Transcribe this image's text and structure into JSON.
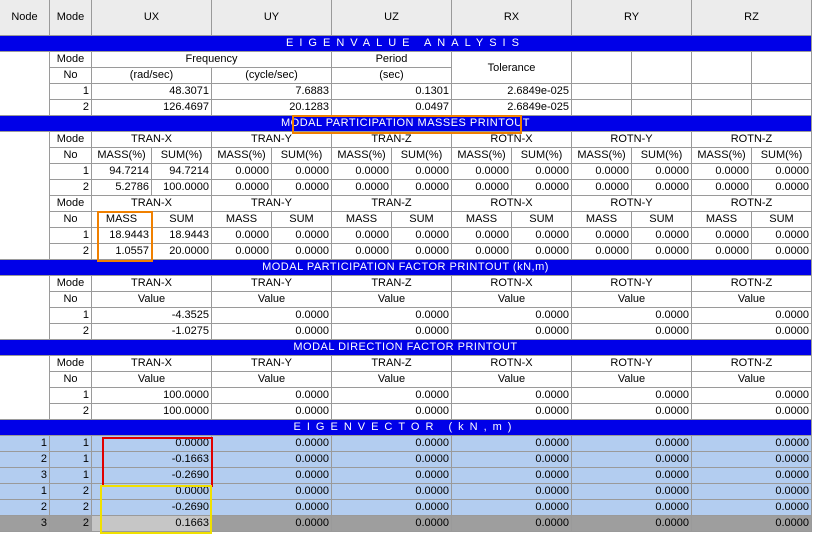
{
  "columns": [
    "Node",
    "Mode",
    "UX",
    "UY",
    "UZ",
    "RX",
    "RY",
    "RZ"
  ],
  "eigenvalue": {
    "title": "EIGENVALUE ANALYSIS",
    "mode_label": [
      "Mode",
      "No"
    ],
    "frequency_label": "Frequency",
    "rad_label": "(rad/sec)",
    "cycle_label": "(cycle/sec)",
    "period_label": "Period",
    "sec_label": "(sec)",
    "tolerance_label": "Tolerance",
    "rows": [
      {
        "mode": "1",
        "rad": "48.3071",
        "cycle": "7.6883",
        "period": "0.1301",
        "tol": "2.6849e-025"
      },
      {
        "mode": "2",
        "rad": "126.4697",
        "cycle": "20.1283",
        "period": "0.0497",
        "tol": "2.6849e-025"
      }
    ]
  },
  "mass_participation": {
    "title": "MODAL PARTICIPATION MASSES PRINTOUT",
    "groups": [
      "TRAN-X",
      "TRAN-Y",
      "TRAN-Z",
      "ROTN-X",
      "ROTN-Y",
      "ROTN-Z"
    ],
    "pct_sub": [
      "MASS(%)",
      "SUM(%)"
    ],
    "pct_rows": [
      {
        "mode": "1",
        "vals": [
          "94.7214",
          "94.7214",
          "0.0000",
          "0.0000",
          "0.0000",
          "0.0000",
          "0.0000",
          "0.0000",
          "0.0000",
          "0.0000",
          "0.0000",
          "0.0000"
        ]
      },
      {
        "mode": "2",
        "vals": [
          "5.2786",
          "100.0000",
          "0.0000",
          "0.0000",
          "0.0000",
          "0.0000",
          "0.0000",
          "0.0000",
          "0.0000",
          "0.0000",
          "0.0000",
          "0.0000"
        ]
      }
    ],
    "abs_sub": [
      "MASS",
      "SUM"
    ],
    "abs_rows": [
      {
        "mode": "1",
        "vals": [
          "18.9443",
          "18.9443",
          "0.0000",
          "0.0000",
          "0.0000",
          "0.0000",
          "0.0000",
          "0.0000",
          "0.0000",
          "0.0000",
          "0.0000",
          "0.0000"
        ]
      },
      {
        "mode": "2",
        "vals": [
          "1.0557",
          "20.0000",
          "0.0000",
          "0.0000",
          "0.0000",
          "0.0000",
          "0.0000",
          "0.0000",
          "0.0000",
          "0.0000",
          "0.0000",
          "0.0000"
        ]
      }
    ]
  },
  "participation_factor": {
    "title": "MODAL PARTICIPATION FACTOR PRINTOUT (kN,m)",
    "value_label": "Value",
    "rows": [
      {
        "mode": "1",
        "vals": [
          "-4.3525",
          "0.0000",
          "0.0000",
          "0.0000",
          "0.0000",
          "0.0000"
        ]
      },
      {
        "mode": "2",
        "vals": [
          "-1.0275",
          "0.0000",
          "0.0000",
          "0.0000",
          "0.0000",
          "0.0000"
        ]
      }
    ]
  },
  "direction_factor": {
    "title": "MODAL DIRECTION FACTOR PRINTOUT",
    "value_label": "Value",
    "rows": [
      {
        "mode": "1",
        "vals": [
          "100.0000",
          "0.0000",
          "0.0000",
          "0.0000",
          "0.0000",
          "0.0000"
        ]
      },
      {
        "mode": "2",
        "vals": [
          "100.0000",
          "0.0000",
          "0.0000",
          "0.0000",
          "0.0000",
          "0.0000"
        ]
      }
    ]
  },
  "eigenvector": {
    "title": "EIGENVECTOR (kN,m)",
    "rows": [
      {
        "node": "1",
        "mode": "1",
        "vals": [
          "0.0000",
          "0.0000",
          "0.0000",
          "0.0000",
          "0.0000",
          "0.0000"
        ]
      },
      {
        "node": "2",
        "mode": "1",
        "vals": [
          "-0.1663",
          "0.0000",
          "0.0000",
          "0.0000",
          "0.0000",
          "0.0000"
        ]
      },
      {
        "node": "3",
        "mode": "1",
        "vals": [
          "-0.2690",
          "0.0000",
          "0.0000",
          "0.0000",
          "0.0000",
          "0.0000"
        ]
      },
      {
        "node": "1",
        "mode": "2",
        "vals": [
          "0.0000",
          "0.0000",
          "0.0000",
          "0.0000",
          "0.0000",
          "0.0000"
        ]
      },
      {
        "node": "2",
        "mode": "2",
        "vals": [
          "-0.2690",
          "0.0000",
          "0.0000",
          "0.0000",
          "0.0000",
          "0.0000"
        ]
      },
      {
        "node": "3",
        "mode": "2",
        "vals": [
          "0.1663",
          "0.0000",
          "0.0000",
          "0.0000",
          "0.0000",
          "0.0000"
        ]
      }
    ]
  },
  "colors": {
    "band": "#0000e8",
    "selection": "#b3cdf0",
    "highlight_orange": "#f08000",
    "highlight_red": "#e00000",
    "highlight_yellow": "#f0e000"
  }
}
